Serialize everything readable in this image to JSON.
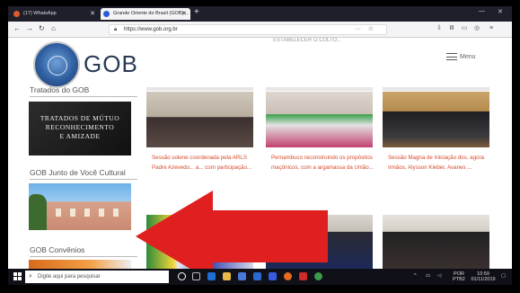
{
  "browser": {
    "tabs": [
      {
        "title": "(17) WhatsApp",
        "close": "✕"
      },
      {
        "title": "Grande Oriente do Brasil (GOB) ...",
        "close": "✕"
      }
    ],
    "new_tab": "+",
    "url": "https://www.gob.org.br",
    "url_menu": "···",
    "nav": {
      "back": "←",
      "forward": "→",
      "reload": "↻",
      "home": "⌂"
    }
  },
  "site": {
    "logo_text": "GOB",
    "menu_label": "Menu",
    "top_faded_text": "ESTABELECER O CULTO..."
  },
  "sidebar": {
    "section1_title": "Tratados do GOB",
    "banner_text_lines": [
      "TRATADOS DE MÚTUO",
      "RECONHECIMENTO",
      "E AMIZADE"
    ],
    "section2_title": "GOB Junto de Você Cultural",
    "section3_title": "GOB Convênios"
  },
  "cards": [
    {
      "text": "Sessão solene coordenada pela ARLS Padre Azevedo... a... com participação..."
    },
    {
      "text": "Pernambuco reconstruindo os propósitos maçônicos, com a argamassa da União..."
    },
    {
      "text": "Sessão Magna de Iniciação dos, agora Irmãos, Alysson Kleber, Avanes ..."
    }
  ],
  "taskbar": {
    "search_placeholder": "Digite aqui para pesquisar",
    "time": "10:59",
    "date": "01/11/2019",
    "lang": "POR PTB2"
  },
  "colors": {
    "arrow": "#e02020",
    "card_text": "#d64a2a",
    "tab_strip": "#1f1f2b"
  }
}
